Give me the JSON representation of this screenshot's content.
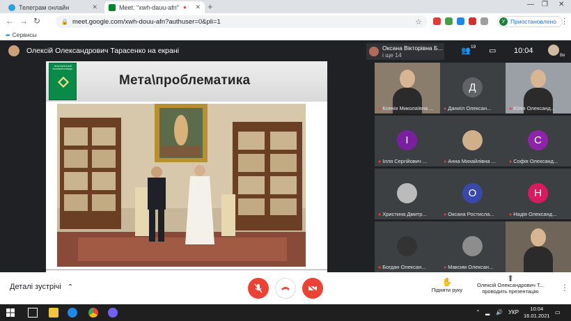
{
  "browser": {
    "tabs": [
      {
        "title": "Телеграм онлайн",
        "active": false,
        "color": "#2aa1da"
      },
      {
        "title": "Meet: \"xwh-dauu-afn\"",
        "active": true,
        "color": "#00832d"
      }
    ],
    "url": "meet.google.com/xwh-douu-afn?authuser=0&pli=1",
    "profile_status": "Приостановлено",
    "profile_initial": "У",
    "bookmarks": [
      "Сервисы"
    ]
  },
  "meet": {
    "presenter_title": "Олексій Олександрович Тарасенко на екрані",
    "pinned_name": "Оксана Вікторівна Б...",
    "pinned_sub": "і ще 14",
    "participant_count": "19",
    "time": "10:04",
    "self_label": "Ви",
    "slide_title": "Мета\\проблематика",
    "logo_text": "ТЕХНОЛОГІЧНИЙ ФАХОВИЙ КОЛЕДЖ",
    "tiles": [
      {
        "name": "Ксенія Миколаївна ...",
        "initial": "",
        "color": "#8a7d6c",
        "kind": "video"
      },
      {
        "name": "Даниїл Олексан...",
        "initial": "Д",
        "color": "#5f6368",
        "kind": "letter"
      },
      {
        "name": "Юлія Олександ...",
        "initial": "",
        "color": "#9aa0a6",
        "kind": "video"
      },
      {
        "name": "Ілля Сергійович ...",
        "initial": "І",
        "color": "#7b1fa2",
        "kind": "letter"
      },
      {
        "name": "Анна Михайлівна ...",
        "initial": "",
        "color": "#d0b08a",
        "kind": "photo"
      },
      {
        "name": "Софія Олександ...",
        "initial": "С",
        "color": "#8e24aa",
        "kind": "letter"
      },
      {
        "name": "Христина Дмитр...",
        "initial": "",
        "color": "#bbbbbb",
        "kind": "photo"
      },
      {
        "name": "Оксана Ростисла...",
        "initial": "О",
        "color": "#3949ab",
        "kind": "letter"
      },
      {
        "name": "Надія Олександ...",
        "initial": "Н",
        "color": "#d81b60",
        "kind": "letter"
      },
      {
        "name": "Богдан Олексан...",
        "initial": "",
        "color": "#333333",
        "kind": "photo"
      },
      {
        "name": "Максим Олексан...",
        "initial": "",
        "color": "#8d8d8d",
        "kind": "photo"
      },
      {
        "name": "",
        "initial": "",
        "color": "#6f6558",
        "kind": "video"
      }
    ],
    "details_label": "Деталі зустрічі",
    "raise_hand_label": "Підняти руку",
    "presenting_label": "Олексій Олександрович Т...",
    "presenting_sub": "проводить презентацію"
  },
  "taskbar": {
    "language": "УКР",
    "time": "10:04",
    "date": "16.01.2021"
  },
  "colors": {
    "accent": "#1a73e8",
    "danger": "#ea4335",
    "dark": "#202124"
  }
}
